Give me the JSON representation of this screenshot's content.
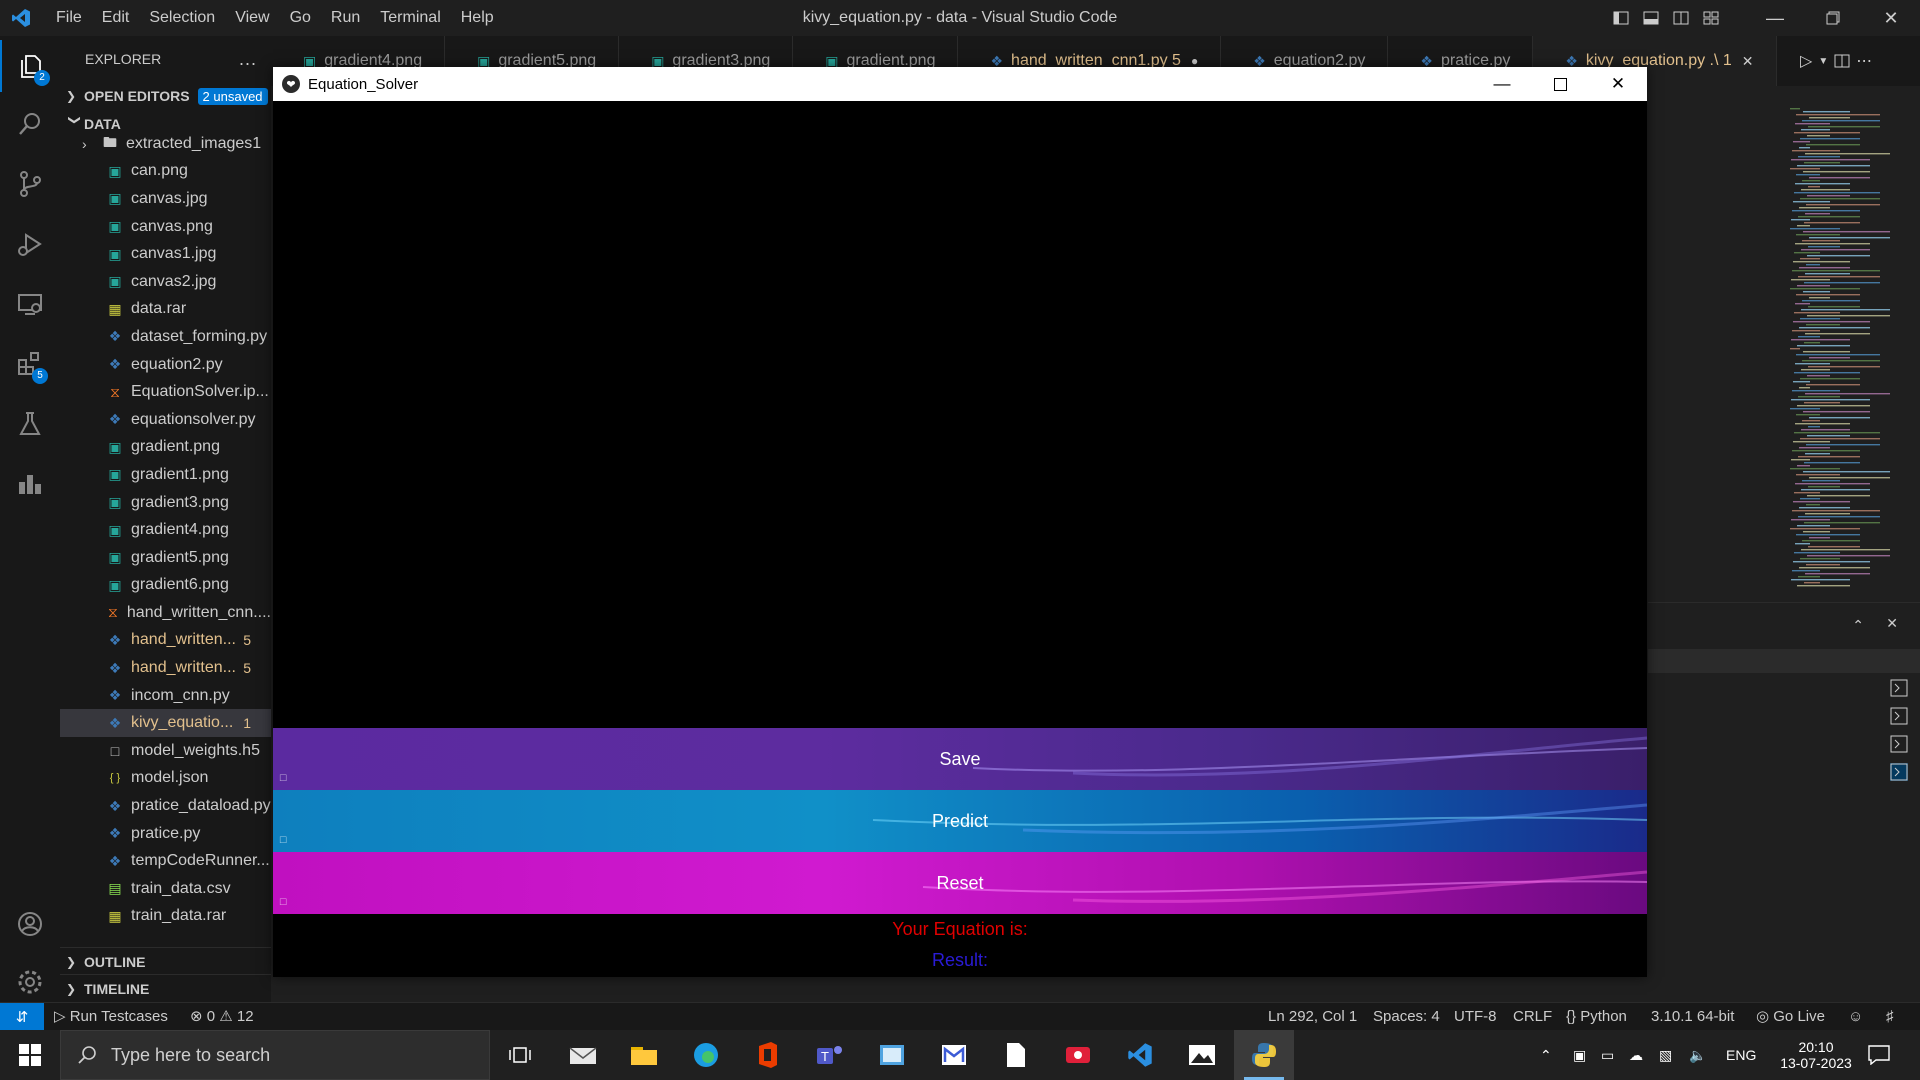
{
  "window": {
    "title": "kivy_equation.py - data - Visual Studio Code",
    "menu": [
      "File",
      "Edit",
      "Selection",
      "View",
      "Go",
      "Run",
      "Terminal",
      "Help"
    ]
  },
  "activity_badges": {
    "explorer": "2",
    "extensions": "5"
  },
  "sidebar": {
    "header": "EXPLORER",
    "more": "...",
    "open_editors": "OPEN EDITORS",
    "unsaved": "2 unsaved",
    "data_section": "DATA",
    "files": [
      {
        "name": "extracted_images1",
        "icon": "folder-icon",
        "mod": false,
        "count": ""
      },
      {
        "name": "can.png",
        "icon": "image-icon",
        "mod": false,
        "count": ""
      },
      {
        "name": "canvas.jpg",
        "icon": "image-icon",
        "mod": false,
        "count": ""
      },
      {
        "name": "canvas.png",
        "icon": "image-icon",
        "mod": false,
        "count": ""
      },
      {
        "name": "canvas1.jpg",
        "icon": "image-icon",
        "mod": false,
        "count": ""
      },
      {
        "name": "canvas2.jpg",
        "icon": "image-icon",
        "mod": false,
        "count": ""
      },
      {
        "name": "data.rar",
        "icon": "archive-icon",
        "mod": false,
        "count": ""
      },
      {
        "name": "dataset_forming.py",
        "icon": "python-icon",
        "mod": false,
        "count": ""
      },
      {
        "name": "equation2.py",
        "icon": "python-icon",
        "mod": false,
        "count": ""
      },
      {
        "name": "EquationSolver.ip...",
        "icon": "jupyter-icon",
        "mod": false,
        "count": ""
      },
      {
        "name": "equationsolver.py",
        "icon": "python-icon",
        "mod": false,
        "count": ""
      },
      {
        "name": "gradient.png",
        "icon": "image-icon",
        "mod": false,
        "count": ""
      },
      {
        "name": "gradient1.png",
        "icon": "image-icon",
        "mod": false,
        "count": ""
      },
      {
        "name": "gradient3.png",
        "icon": "image-icon",
        "mod": false,
        "count": ""
      },
      {
        "name": "gradient4.png",
        "icon": "image-icon",
        "mod": false,
        "count": ""
      },
      {
        "name": "gradient5.png",
        "icon": "image-icon",
        "mod": false,
        "count": ""
      },
      {
        "name": "gradient6.png",
        "icon": "image-icon",
        "mod": false,
        "count": ""
      },
      {
        "name": "hand_written_cnn....",
        "icon": "jupyter-icon",
        "mod": false,
        "count": ""
      },
      {
        "name": "hand_written...",
        "icon": "python-icon",
        "mod": true,
        "count": "5"
      },
      {
        "name": "hand_written...",
        "icon": "python-icon",
        "mod": true,
        "count": "5"
      },
      {
        "name": "incom_cnn.py",
        "icon": "python-icon",
        "mod": false,
        "count": ""
      },
      {
        "name": "kivy_equatio...",
        "icon": "python-icon",
        "mod": true,
        "count": "1",
        "selected": true
      },
      {
        "name": "model_weights.h5",
        "icon": "file-icon",
        "mod": false,
        "count": ""
      },
      {
        "name": "model.json",
        "icon": "json-icon",
        "mod": false,
        "count": ""
      },
      {
        "name": "pratice_dataload.py",
        "icon": "python-icon",
        "mod": false,
        "count": ""
      },
      {
        "name": "pratice.py",
        "icon": "python-icon",
        "mod": false,
        "count": ""
      },
      {
        "name": "tempCodeRunner...",
        "icon": "python-icon",
        "mod": false,
        "count": ""
      },
      {
        "name": "train_data.csv",
        "icon": "csv-icon",
        "mod": false,
        "count": ""
      },
      {
        "name": "train_data.rar",
        "icon": "archive-icon",
        "mod": false,
        "count": ""
      }
    ],
    "outline": "OUTLINE",
    "timeline": "TIMELINE"
  },
  "tabs": [
    {
      "label": "gradient4.png",
      "icon": "image-icon",
      "state": "normal"
    },
    {
      "label": "gradient5.png",
      "icon": "image-icon",
      "state": "normal"
    },
    {
      "label": "gradient3.png",
      "icon": "image-icon",
      "state": "normal"
    },
    {
      "label": "gradient.png",
      "icon": "image-icon",
      "state": "normal"
    },
    {
      "label": "hand_written_cnn1.py 5",
      "icon": "python-icon",
      "state": "mod"
    },
    {
      "label": "equation2.py",
      "icon": "python-icon",
      "state": "normal"
    },
    {
      "label": "pratice.py",
      "icon": "python-icon",
      "state": "normal"
    },
    {
      "label": "kivy_equation.py .\\ 1",
      "icon": "python-icon",
      "state": "active"
    }
  ],
  "app": {
    "title": "Equation_Solver",
    "buttons": {
      "save": "Save",
      "predict": "Predict",
      "reset": "Reset"
    },
    "equation_label": "Your Equation is:",
    "result_label": "Result:",
    "colors": {
      "equation": "#e00000",
      "result": "#2a1bd6"
    }
  },
  "statusbar": {
    "run_testcases": "Run Testcases",
    "errors": "0",
    "warnings": "12",
    "position": "Ln 292, Col 1",
    "spaces": "Spaces: 4",
    "encoding": "UTF-8",
    "eol": "CRLF",
    "language": "Python",
    "interpreter": "3.10.1 64-bit",
    "golive": "Go Live"
  },
  "taskbar": {
    "search_placeholder": "Type here to search",
    "lang": "ENG",
    "time": "20:10",
    "date": "13-07-2023"
  }
}
